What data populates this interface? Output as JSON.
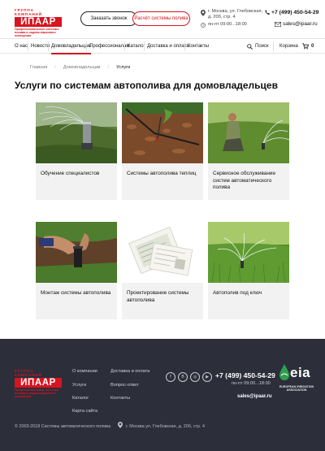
{
  "header": {
    "logo": {
      "group": "ГРУППА КОМПАНИЙ",
      "name": "ИПААР",
      "tagline": "Профессиональные системы полива и садово-паркового освещения"
    },
    "call_button": "Заказать звонок",
    "calc_button": "Расчёт системы полива",
    "address": "г. Москва, ул. Глебовская, д. 20б, стр. 4",
    "hours": "пн-пт 09:00...18:00",
    "phone": "+7 (499) 450-54-29",
    "email": "sales@ipaar.ru"
  },
  "nav": {
    "items": [
      "О нас",
      "Новости",
      "Домовладельцам",
      "Профессионалам",
      "Каталог",
      "Доставка и оплата",
      "Контакты"
    ],
    "search": "Поиск",
    "cart": "Корзина",
    "cart_count": "0"
  },
  "breadcrumbs": [
    "Главная",
    "Домовладельцам",
    "Услуги"
  ],
  "page_title": "Услуги по системам автополива для домовладельцев",
  "cards": [
    {
      "title": "Обучение специалистов"
    },
    {
      "title": "Системы автополива теплиц"
    },
    {
      "title": "Сервисное обслуживание систем автоматического полива"
    },
    {
      "title": "Монтаж системы автополива"
    },
    {
      "title": "Проектирование системы автополива"
    },
    {
      "title": "Автополив под ключ"
    }
  ],
  "footer": {
    "logo": {
      "group": "ГРУППА КОМПАНИЙ",
      "name": "ИПААР",
      "tagline": "Профессиональные системы полива и садово-паркового освещения"
    },
    "col1": [
      "О компании",
      "Услуги",
      "Каталог",
      "Карта сайта"
    ],
    "col2": [
      "Доставка и оплата",
      "Вопрос-ответ",
      "Контакты"
    ],
    "socials": [
      "f",
      "В",
      "◎",
      "▶"
    ],
    "phone": "+7 (499) 450-54-29",
    "hours": "пн-пт 09:00...18:00",
    "email": "sales@ipaar.ru",
    "eia": {
      "word": "eia",
      "sub": "EUROPEAN IRRIGATION ASSOCIATION"
    },
    "copyright": "© 2003-2018 Системы автоматического полива",
    "address": "г. Москва ул. Глебовская, д. 20б, стр. 4"
  },
  "colors": {
    "brand_red": "#d7141f",
    "footer_bg": "#2c2e3a",
    "card_bg": "#f2f2f2"
  }
}
